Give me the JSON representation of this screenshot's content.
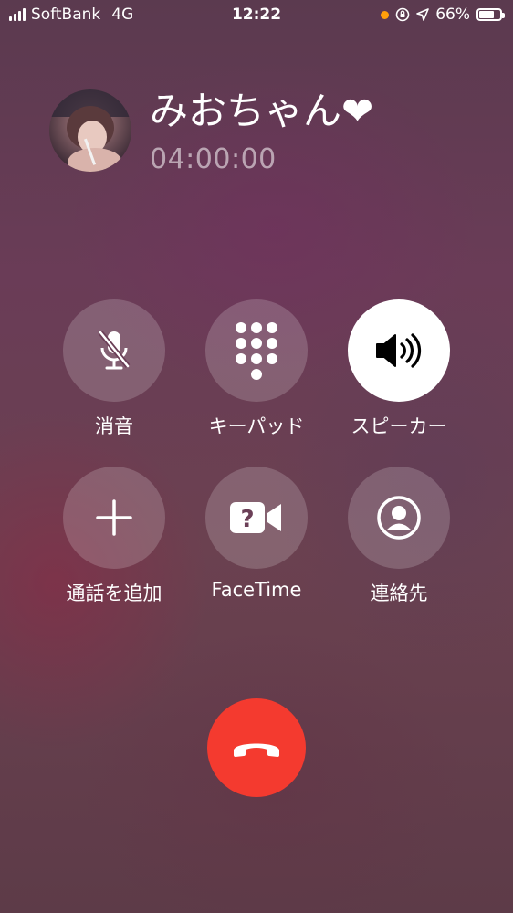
{
  "status_bar": {
    "carrier": "SoftBank",
    "network": "4G",
    "time": "12:22",
    "battery_percent": "66%",
    "battery_level": 0.66,
    "signal_bars": 4,
    "icons": [
      "signal-icon",
      "recording-dot-icon",
      "orientation-lock-icon",
      "location-icon",
      "battery-icon"
    ]
  },
  "caller": {
    "name": "みおちゃん❤",
    "duration": "04:00:00",
    "avatar_icon": "contact-photo"
  },
  "controls": {
    "mute": {
      "label": "消音",
      "icon": "mic-slash-icon"
    },
    "keypad": {
      "label": "キーパッド",
      "icon": "keypad-icon"
    },
    "speaker": {
      "label": "スピーカー",
      "icon": "speaker-icon",
      "active": true
    },
    "add_call": {
      "label": "通話を追加",
      "icon": "plus-icon"
    },
    "facetime": {
      "label": "FaceTime",
      "icon": "video-question-icon"
    },
    "contacts": {
      "label": "連絡先",
      "icon": "person-circle-icon"
    }
  },
  "end_call": {
    "icon": "phone-down-icon"
  },
  "colors": {
    "end_call_red": "#f43a2f",
    "recording_dot": "#ff9f0a",
    "button_bg": "rgba(255,255,255,0.18)",
    "active_button_bg": "#ffffff"
  }
}
